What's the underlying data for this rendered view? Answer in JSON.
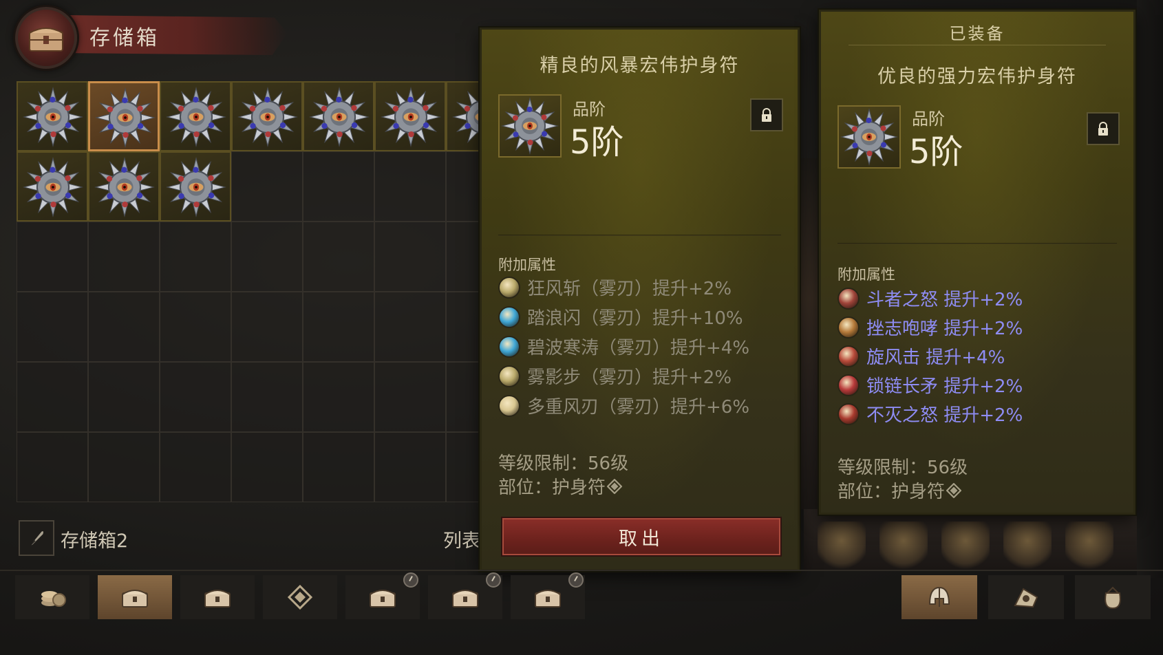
{
  "storage": {
    "title": "存储箱",
    "name": "存储箱2",
    "list_label": "列表"
  },
  "grid": {
    "columns": 7,
    "rows": 6,
    "filled_count": 10,
    "selected_index": 1
  },
  "tooltip_main": {
    "name": "精良的风暴宏伟护身符",
    "tier_label": "品阶",
    "tier_value": "5阶",
    "attr_header": "附加属性",
    "attributes": [
      {
        "text": "狂风斩（雾刃）提升+2%",
        "icon": "gale-slash-icon",
        "color": "#b9a96a"
      },
      {
        "text": "踏浪闪（雾刃）提升+10%",
        "icon": "wave-dash-icon",
        "color": "#3fa7d6"
      },
      {
        "text": "碧波寒涛（雾刃）提升+4%",
        "icon": "blue-wave-icon",
        "color": "#3fa7d6"
      },
      {
        "text": "雾影步（雾刃）提升+2%",
        "icon": "mist-step-icon",
        "color": "#b9a96a"
      },
      {
        "text": "多重风刃（雾刃）提升+6%",
        "icon": "wind-blade-icon",
        "color": "#d8c690"
      }
    ],
    "level_req": "等级限制：56级",
    "slot": "部位：护身符",
    "take_button": "取出"
  },
  "tooltip_equipped": {
    "header": "已装备",
    "name": "优良的强力宏伟护身符",
    "tier_label": "品阶",
    "tier_value": "5阶",
    "attr_header": "附加属性",
    "attributes": [
      {
        "text": "斗者之怒  提升+2%",
        "icon": "fighter-rage-icon",
        "color": "#a0443a"
      },
      {
        "text": "挫志咆哮  提升+2%",
        "icon": "demoralizing-roar-icon",
        "color": "#b57a3a"
      },
      {
        "text": "旋风击  提升+4%",
        "icon": "whirlwind-icon",
        "color": "#b84a3a"
      },
      {
        "text": "锁链长矛  提升+2%",
        "icon": "chain-spear-icon",
        "color": "#b83a3a"
      },
      {
        "text": "不灭之怒  提升+2%",
        "icon": "undying-rage-icon",
        "color": "#a83a2e"
      }
    ],
    "level_req": "等级限制：56级",
    "slot": "部位：护身符"
  },
  "tabs": [
    {
      "icon": "coins-icon",
      "locked": false,
      "active": false
    },
    {
      "icon": "storage-chest-icon",
      "locked": false,
      "active": true
    },
    {
      "icon": "storage-chest-2-icon",
      "locked": false,
      "active": false
    },
    {
      "icon": "gem-icon",
      "locked": false,
      "active": false
    },
    {
      "icon": "locked-chest-1-icon",
      "locked": true,
      "active": false
    },
    {
      "icon": "locked-chest-2-icon",
      "locked": true,
      "active": false
    },
    {
      "icon": "locked-chest-3-icon",
      "locked": true,
      "active": false
    }
  ],
  "right_tabs": [
    {
      "icon": "helmet-icon",
      "active": true
    },
    {
      "icon": "material-icon",
      "active": false
    },
    {
      "icon": "loot-bag-icon",
      "active": false
    }
  ]
}
